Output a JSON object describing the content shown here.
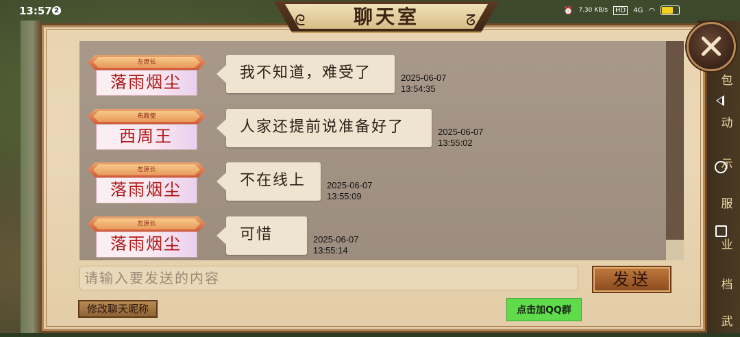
{
  "status_bar": {
    "time": "13:57",
    "notification_count": "2",
    "net_speed": "7.30 KB/s",
    "hd_label": "HD",
    "network": "4G",
    "battery_color": "#f2d21e",
    "battery_level": 0.72
  },
  "dialog": {
    "title": "聊天室",
    "close_icon": "close-icon"
  },
  "messages": [
    {
      "rank": "左庶长",
      "name": "落雨烟尘",
      "text": "我不知道，难受了",
      "date": "2025-06-07",
      "time": "13:54:35"
    },
    {
      "rank": "布政使",
      "name": "西周王",
      "text": "人家还提前说准备好了",
      "date": "2025-06-07",
      "time": "13:55:02"
    },
    {
      "rank": "左庶长",
      "name": "落雨烟尘",
      "text": "不在线上",
      "date": "2025-06-07",
      "time": "13:55:09"
    },
    {
      "rank": "左庶长",
      "name": "落雨烟尘",
      "text": "可惜",
      "date": "2025-06-07",
      "time": "13:55:14"
    }
  ],
  "input": {
    "placeholder": "请输入要发送的内容",
    "value": ""
  },
  "buttons": {
    "send": "发送",
    "rename": "修改聊天昵称",
    "join_qq": "点击加QQ群"
  },
  "side_menu": [
    "包",
    "动",
    "示",
    "服",
    "业",
    "档",
    "武"
  ],
  "colors": {
    "name_red": "#b01818",
    "qq_button_green": "#5fdb4c",
    "dialog_border": "#6e4a2a"
  }
}
